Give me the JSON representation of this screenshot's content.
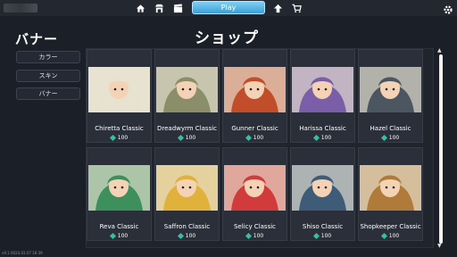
{
  "topbar": {
    "play_label": "Play",
    "nav_icons": [
      "home-icon",
      "shop-stall-icon",
      "clapperboard-icon",
      "rank-up-icon",
      "cart-icon"
    ]
  },
  "sidebar": {
    "title": "バナー",
    "buttons": [
      "カラー",
      "スキン",
      "バナー"
    ]
  },
  "shop": {
    "title": "ショップ",
    "items": [
      {
        "name": "Chiretta Classic",
        "price": "100",
        "color": "#e7e1cf"
      },
      {
        "name": "Dreadwyrm Classic",
        "price": "100",
        "color": "#8a8f6a"
      },
      {
        "name": "Gunner Classic",
        "price": "100",
        "color": "#c24d2a"
      },
      {
        "name": "Harissa Classic",
        "price": "100",
        "color": "#7a5fa8"
      },
      {
        "name": "Hazel Classic",
        "price": "100",
        "color": "#4c5660"
      },
      {
        "name": "Reva Classic",
        "price": "100",
        "color": "#3d8f5b"
      },
      {
        "name": "Saffron Classic",
        "price": "100",
        "color": "#e0b23c"
      },
      {
        "name": "Selicy Classic",
        "price": "100",
        "color": "#d23b3b"
      },
      {
        "name": "Shiso Classic",
        "price": "100",
        "color": "#3e5b78"
      },
      {
        "name": "Shopkeeper Classic",
        "price": "100",
        "color": "#b07a3a"
      }
    ]
  },
  "footer": {
    "build": "v9.1.0024.03.07 16:39"
  }
}
